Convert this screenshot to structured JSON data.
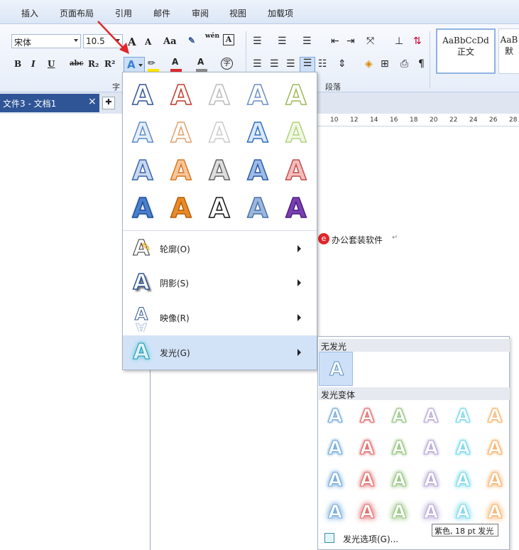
{
  "tabs": [
    "插入",
    "页面布局",
    "引用",
    "邮件",
    "审阅",
    "视图",
    "加载项"
  ],
  "font": {
    "name": "宋体",
    "size": "10.5"
  },
  "toolbar": {
    "bold": "B",
    "italic": "I",
    "underline": "U",
    "strike": "abc",
    "sub": "R₂",
    "sup": "R²",
    "grow": "A",
    "shrink": "A",
    "case": "Aa",
    "effect": "A",
    "pinyin": "wén",
    "fontcolor": "A",
    "charshade": "A",
    "enclose": "字",
    "pilcrow": "¶"
  },
  "groups": {
    "font": "字",
    "paragraph": "段落"
  },
  "styles": [
    {
      "preview": "AaBbCcDd",
      "name": "正文"
    },
    {
      "preview": "AaB",
      "name": "默"
    }
  ],
  "doc": {
    "tab": "文件3 - 文档1",
    "close": "×",
    "text": "办公套装软件",
    "ret": "↵"
  },
  "ruler": [
    "10",
    "12",
    "14",
    "16",
    "18",
    "20",
    "22",
    "24",
    "26",
    "28"
  ],
  "effects_menu": {
    "outline": "轮廓(O)",
    "shadow": "阴影(S)",
    "reflection": "映像(R)",
    "glow": "发光(G)"
  },
  "glow_menu": {
    "no_glow": "无发光",
    "variants": "发光变体",
    "options": "发光选项(G)...",
    "tooltip": "紫色, 18 pt 发光"
  },
  "glyph": "A",
  "colors": {
    "accent": "#2f5597",
    "highlight": "#cde0f7",
    "menuhover": "#d3e3f7",
    "red": "#e0282c"
  }
}
